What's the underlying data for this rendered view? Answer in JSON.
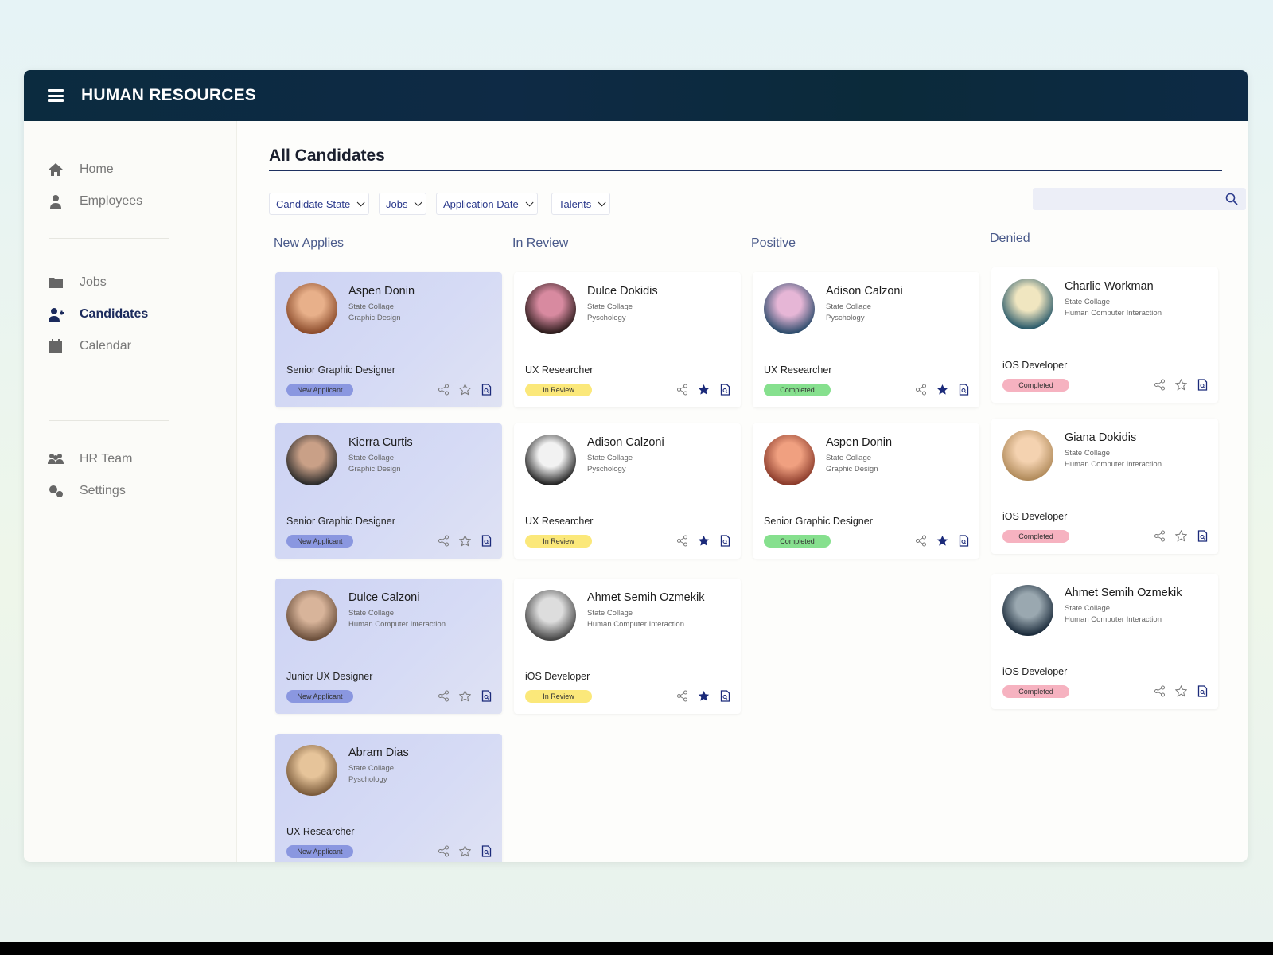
{
  "app": {
    "title": "HUMAN RESOURCES"
  },
  "sidebar": {
    "items": [
      {
        "label": "Home",
        "icon": "home-icon"
      },
      {
        "label": "Employees",
        "icon": "user-icon"
      },
      {
        "label": "Jobs",
        "icon": "folder-icon"
      },
      {
        "label": "Candidates",
        "icon": "user-plus-icon",
        "active": true
      },
      {
        "label": "Calendar",
        "icon": "calendar-icon"
      },
      {
        "label": "HR Team",
        "icon": "team-icon"
      },
      {
        "label": "Settings",
        "icon": "gears-icon"
      }
    ]
  },
  "main": {
    "title": "All Candidates",
    "filters": [
      "Candidate State",
      "Jobs",
      "Application Date",
      "Talents"
    ],
    "search": {
      "placeholder": ""
    },
    "colors": {
      "new": "#8a97e0",
      "review": "#fbe87a",
      "positive": "#86e08e",
      "denied": "#f6b2c0",
      "star": "#1b2a7a"
    },
    "columns": [
      {
        "title": "New Applies",
        "cards": [
          {
            "name": "Aspen Donin",
            "school": "State Collage",
            "field": "Graphic Design",
            "role": "Senior Graphic Designer",
            "status": "New Applicant",
            "starred": false,
            "avatar": [
              "#e8b08a",
              "#8a4a2a"
            ]
          },
          {
            "name": "Kierra Curtis",
            "school": "State Collage",
            "field": "Graphic Design",
            "role": "Senior Graphic Designer",
            "status": "New Applicant",
            "starred": false,
            "avatar": [
              "#c9a087",
              "#2a2a2a"
            ]
          },
          {
            "name": "Dulce Calzoni",
            "school": "State Collage",
            "field": "Human Computer Interaction",
            "role": "Junior UX Designer",
            "status": "New Applicant",
            "starred": false,
            "avatar": [
              "#d8b49a",
              "#6a4e3a"
            ]
          },
          {
            "name": "Abram Dias",
            "school": "State Collage",
            "field": "Pyschology",
            "role": "UX Researcher",
            "status": "New Applicant",
            "starred": false,
            "avatar": [
              "#e6c49a",
              "#7a5a3a"
            ]
          }
        ]
      },
      {
        "title": "In Review",
        "cards": [
          {
            "name": "Dulce Dokidis",
            "school": "State Collage",
            "field": "Pyschology",
            "role": "UX Researcher",
            "status": "In Review",
            "starred": true,
            "avatar": [
              "#d88aa0",
              "#2a1a1a"
            ]
          },
          {
            "name": "Adison Calzoni",
            "school": "State Collage",
            "field": "Pyschology",
            "role": "UX Researcher",
            "status": "In Review",
            "starred": true,
            "avatar": [
              "#f2f2f2",
              "#222222"
            ]
          },
          {
            "name": "Ahmet Semih Ozmekik",
            "school": "State Collage",
            "field": "Human Computer Interaction",
            "role": "iOS Developer",
            "status": "In Review",
            "starred": true,
            "avatar": [
              "#dddddd",
              "#444444"
            ]
          }
        ]
      },
      {
        "title": "Positive",
        "cards": [
          {
            "name": "Adison Calzoni",
            "school": "State Collage",
            "field": "Pyschology",
            "role": "UX Researcher",
            "status": "Completed",
            "starred": true,
            "avatar": [
              "#e6b6d6",
              "#2a4a6a"
            ]
          },
          {
            "name": "Aspen Donin",
            "school": "State Collage",
            "field": "Graphic Design",
            "role": "Senior Graphic Designer",
            "status": "Completed",
            "starred": true,
            "avatar": [
              "#f0a080",
              "#8a3a2a"
            ]
          }
        ]
      },
      {
        "title": "Denied",
        "cards": [
          {
            "name": "Charlie Workman",
            "school": "State Collage",
            "field": "Human Computer Interaction",
            "role": "iOS Developer",
            "status": "Completed",
            "starred": false,
            "avatar": [
              "#f0e6c0",
              "#2a5a6a"
            ]
          },
          {
            "name": "Giana Dokidis",
            "school": "State Collage",
            "field": "Human Computer Interaction",
            "role": "iOS Developer",
            "status": "Completed",
            "starred": false,
            "avatar": [
              "#f4d2b0",
              "#b08a5a"
            ]
          },
          {
            "name": "Ahmet Semih Ozmekik",
            "school": "State Collage",
            "field": "Human Computer Interaction",
            "role": "iOS Developer",
            "status": "Completed",
            "starred": false,
            "avatar": [
              "#9aa8b0",
              "#1a2a3a"
            ]
          }
        ]
      }
    ]
  }
}
